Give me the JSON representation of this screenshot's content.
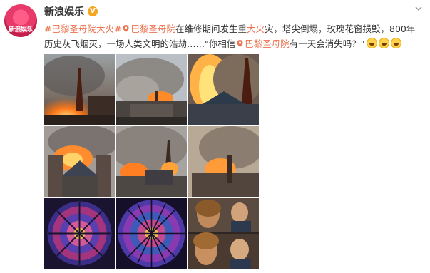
{
  "account": {
    "name": "新浪娱乐",
    "avatar_text": "新浪娱乐",
    "verified_mark": "V"
  },
  "post": {
    "tag1": "#巴黎圣母院大火#",
    "link1": "巴黎圣母院",
    "segment1": "在维修期间发生重",
    "fire_word": "大火",
    "segment2": "灾，塔尖倒塌，玫瑰花窗损毁，800年历史灰飞烟灭，一场人类文明的浩劫……\"你相信",
    "link2": "巴黎圣母院",
    "segment3": "有一天会消失吗？\""
  },
  "images": [
    {
      "name": "cathedral-fire-spire-image",
      "kind": "fire"
    },
    {
      "name": "cathedral-smoke-wide-image",
      "kind": "smoke"
    },
    {
      "name": "cathedral-spire-collapse-image",
      "kind": "spire"
    },
    {
      "name": "cathedral-towers-fire-image",
      "kind": "towers"
    },
    {
      "name": "cathedral-roof-fire-image",
      "kind": "roof"
    },
    {
      "name": "cathedral-fire-night-image",
      "kind": "night"
    },
    {
      "name": "rose-window-image-1",
      "kind": "rose"
    },
    {
      "name": "rose-window-image-2",
      "kind": "rose2"
    },
    {
      "name": "movie-still-image",
      "kind": "movie"
    }
  ],
  "colors": {
    "link": "#eb7350",
    "verified": "#f5a623",
    "brand": "#e83a6a"
  }
}
